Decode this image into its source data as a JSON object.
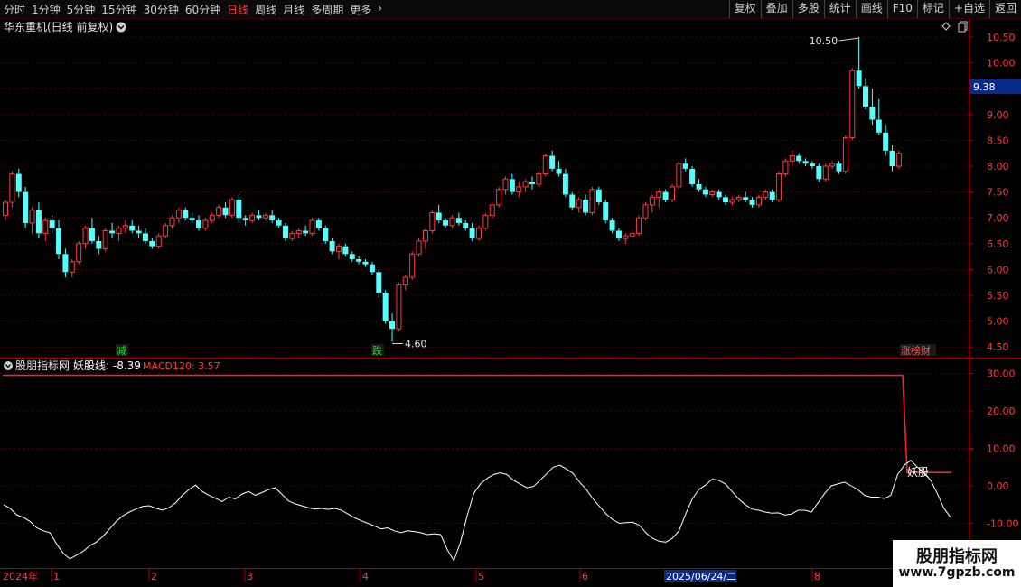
{
  "toolbar": {
    "left_items": [
      "分时",
      "1分钟",
      "5分钟",
      "15分钟",
      "30分钟",
      "60分钟",
      "日线",
      "周线",
      "月线",
      "多周期",
      "更多"
    ],
    "active": "日线",
    "right_items": [
      "复权",
      "叠加",
      "多股",
      "统计",
      "画线",
      "F10",
      "标记",
      "+自选",
      "返回"
    ]
  },
  "header": {
    "stock_title": "华东重机(日线 前复权)"
  },
  "price_panel": {
    "y_ticks": [
      "10.50",
      "10.00",
      "9.50",
      "9.00",
      "8.50",
      "8.00",
      "7.50",
      "7.00",
      "6.50",
      "6.00",
      "5.50",
      "5.00",
      "4.50"
    ],
    "current_price": "9.38",
    "max_label": "10.50",
    "min_label": "4.60",
    "markers": [
      {
        "text": "减",
        "color": "#2bdc2b"
      },
      {
        "text": "跌",
        "color": "#2bdc2b"
      },
      {
        "text": "涨榜财",
        "color": "#ff5a5a"
      }
    ]
  },
  "indicator_panel": {
    "name": "股朋指标网",
    "line1_label": "妖股线: -8.39",
    "line2_label": "MACD120: 3.57",
    "y_ticks": [
      "30.00",
      "20.00",
      "10.00",
      "0.00",
      "-10.00"
    ],
    "signal_label": "妖股"
  },
  "date_axis": {
    "year_label": "2024年",
    "month_labels": [
      "1",
      "2",
      "3",
      "4",
      "5",
      "6",
      "8"
    ],
    "selected_date": "2025/06/24/二"
  },
  "watermark": {
    "line1": "股朋指标网",
    "line2": "www.7gpzb.com"
  },
  "colors": {
    "up": "#ff3b3b",
    "down": "#54ffff",
    "bg": "#000000",
    "grid": "#7a0000",
    "axis": "#aa0000"
  },
  "chart_data": {
    "type": "candlestick",
    "title": "华东重机(日线 前复权)",
    "ylim": [
      4.35,
      10.65
    ],
    "candles": [
      [
        7.05,
        7.35,
        6.95,
        7.3
      ],
      [
        7.3,
        7.9,
        7.2,
        7.85
      ],
      [
        7.85,
        7.95,
        7.4,
        7.5
      ],
      [
        7.5,
        7.6,
        6.8,
        6.9
      ],
      [
        6.9,
        7.2,
        6.7,
        7.15
      ],
      [
        7.15,
        7.3,
        6.6,
        6.7
      ],
      [
        6.7,
        7.0,
        6.55,
        6.95
      ],
      [
        6.95,
        7.05,
        6.7,
        6.8
      ],
      [
        6.8,
        6.95,
        6.2,
        6.3
      ],
      [
        6.3,
        6.4,
        5.85,
        5.95
      ],
      [
        5.95,
        6.2,
        5.85,
        6.15
      ],
      [
        6.15,
        6.55,
        6.1,
        6.5
      ],
      [
        6.5,
        6.85,
        6.4,
        6.8
      ],
      [
        6.8,
        7.0,
        6.5,
        6.55
      ],
      [
        6.55,
        6.65,
        6.3,
        6.4
      ],
      [
        6.4,
        6.8,
        6.35,
        6.75
      ],
      [
        6.75,
        6.9,
        6.6,
        6.7
      ],
      [
        6.7,
        6.85,
        6.55,
        6.8
      ],
      [
        6.8,
        6.95,
        6.7,
        6.85
      ],
      [
        6.85,
        6.95,
        6.7,
        6.75
      ],
      [
        6.75,
        6.85,
        6.6,
        6.7
      ],
      [
        6.7,
        6.8,
        6.5,
        6.55
      ],
      [
        6.55,
        6.6,
        6.4,
        6.45
      ],
      [
        6.45,
        6.7,
        6.4,
        6.65
      ],
      [
        6.65,
        6.9,
        6.6,
        6.85
      ],
      [
        6.85,
        7.05,
        6.8,
        7.0
      ],
      [
        7.0,
        7.2,
        6.9,
        7.15
      ],
      [
        7.15,
        7.2,
        6.95,
        7.0
      ],
      [
        7.0,
        7.1,
        6.9,
        6.95
      ],
      [
        6.95,
        7.05,
        6.75,
        6.8
      ],
      [
        6.8,
        7.0,
        6.75,
        6.95
      ],
      [
        6.95,
        7.1,
        6.9,
        7.05
      ],
      [
        7.05,
        7.25,
        7.0,
        7.2
      ],
      [
        7.2,
        7.3,
        7.0,
        7.05
      ],
      [
        7.05,
        7.4,
        7.0,
        7.35
      ],
      [
        7.35,
        7.45,
        6.9,
        7.0
      ],
      [
        7.0,
        7.05,
        6.85,
        6.95
      ],
      [
        6.95,
        7.1,
        6.9,
        7.05
      ],
      [
        7.05,
        7.15,
        6.95,
        7.0
      ],
      [
        7.0,
        7.1,
        6.95,
        7.05
      ],
      [
        7.05,
        7.15,
        6.9,
        6.95
      ],
      [
        6.95,
        7.0,
        6.8,
        6.85
      ],
      [
        6.85,
        6.9,
        6.55,
        6.6
      ],
      [
        6.6,
        6.75,
        6.55,
        6.7
      ],
      [
        6.7,
        6.8,
        6.6,
        6.75
      ],
      [
        6.75,
        6.85,
        6.65,
        6.7
      ],
      [
        6.7,
        7.0,
        6.65,
        6.95
      ],
      [
        6.95,
        7.0,
        6.75,
        6.8
      ],
      [
        6.8,
        6.85,
        6.5,
        6.55
      ],
      [
        6.55,
        6.6,
        6.3,
        6.35
      ],
      [
        6.35,
        6.5,
        6.2,
        6.45
      ],
      [
        6.45,
        6.5,
        6.25,
        6.3
      ],
      [
        6.3,
        6.35,
        6.15,
        6.2
      ],
      [
        6.2,
        6.25,
        6.1,
        6.15
      ],
      [
        6.15,
        6.2,
        6.05,
        6.1
      ],
      [
        6.1,
        6.15,
        5.9,
        5.95
      ],
      [
        5.95,
        6.0,
        5.45,
        5.55
      ],
      [
        5.55,
        5.6,
        4.95,
        5.0
      ],
      [
        5.0,
        5.15,
        4.6,
        4.85
      ],
      [
        4.85,
        5.75,
        4.8,
        5.7
      ],
      [
        5.7,
        5.9,
        5.6,
        5.85
      ],
      [
        5.85,
        6.35,
        5.8,
        6.3
      ],
      [
        6.3,
        6.6,
        6.25,
        6.55
      ],
      [
        6.55,
        6.8,
        6.4,
        6.75
      ],
      [
        6.75,
        7.15,
        6.7,
        7.1
      ],
      [
        7.1,
        7.25,
        6.9,
        6.95
      ],
      [
        6.95,
        7.0,
        6.8,
        6.85
      ],
      [
        6.85,
        7.05,
        6.8,
        7.0
      ],
      [
        7.0,
        7.1,
        6.85,
        6.9
      ],
      [
        6.9,
        6.95,
        6.75,
        6.8
      ],
      [
        6.8,
        6.9,
        6.55,
        6.6
      ],
      [
        6.6,
        6.85,
        6.55,
        6.8
      ],
      [
        6.8,
        7.1,
        6.75,
        7.05
      ],
      [
        7.05,
        7.3,
        7.0,
        7.25
      ],
      [
        7.25,
        7.6,
        7.2,
        7.55
      ],
      [
        7.55,
        7.8,
        7.45,
        7.75
      ],
      [
        7.75,
        7.85,
        7.45,
        7.5
      ],
      [
        7.5,
        7.7,
        7.4,
        7.6
      ],
      [
        7.6,
        7.75,
        7.5,
        7.7
      ],
      [
        7.7,
        7.8,
        7.55,
        7.65
      ],
      [
        7.65,
        7.9,
        7.6,
        7.85
      ],
      [
        7.85,
        8.25,
        7.8,
        8.2
      ],
      [
        8.2,
        8.3,
        7.9,
        7.95
      ],
      [
        7.95,
        8.1,
        7.8,
        7.85
      ],
      [
        7.85,
        7.95,
        7.4,
        7.45
      ],
      [
        7.45,
        7.5,
        7.15,
        7.2
      ],
      [
        7.2,
        7.4,
        7.1,
        7.35
      ],
      [
        7.35,
        7.45,
        7.05,
        7.1
      ],
      [
        7.1,
        7.6,
        7.05,
        7.55
      ],
      [
        7.55,
        7.6,
        7.25,
        7.3
      ],
      [
        7.3,
        7.35,
        6.9,
        6.95
      ],
      [
        6.95,
        7.0,
        6.7,
        6.75
      ],
      [
        6.75,
        6.8,
        6.55,
        6.6
      ],
      [
        6.6,
        6.7,
        6.5,
        6.65
      ],
      [
        6.65,
        6.75,
        6.6,
        6.7
      ],
      [
        6.7,
        7.05,
        6.65,
        7.0
      ],
      [
        7.0,
        7.3,
        6.95,
        7.25
      ],
      [
        7.25,
        7.45,
        7.1,
        7.4
      ],
      [
        7.4,
        7.55,
        7.2,
        7.5
      ],
      [
        7.5,
        7.55,
        7.3,
        7.35
      ],
      [
        7.35,
        7.65,
        7.3,
        7.6
      ],
      [
        7.6,
        8.1,
        7.55,
        8.05
      ],
      [
        8.05,
        8.15,
        7.9,
        7.95
      ],
      [
        7.95,
        8.0,
        7.6,
        7.65
      ],
      [
        7.65,
        7.75,
        7.5,
        7.55
      ],
      [
        7.55,
        7.6,
        7.4,
        7.45
      ],
      [
        7.45,
        7.55,
        7.4,
        7.5
      ],
      [
        7.5,
        7.55,
        7.35,
        7.4
      ],
      [
        7.4,
        7.45,
        7.25,
        7.3
      ],
      [
        7.3,
        7.4,
        7.25,
        7.35
      ],
      [
        7.35,
        7.45,
        7.3,
        7.4
      ],
      [
        7.4,
        7.5,
        7.3,
        7.35
      ],
      [
        7.35,
        7.4,
        7.2,
        7.25
      ],
      [
        7.25,
        7.45,
        7.2,
        7.4
      ],
      [
        7.4,
        7.55,
        7.35,
        7.5
      ],
      [
        7.5,
        7.55,
        7.3,
        7.35
      ],
      [
        7.35,
        7.9,
        7.3,
        7.85
      ],
      [
        7.85,
        8.15,
        7.8,
        8.1
      ],
      [
        8.1,
        8.3,
        8.0,
        8.2
      ],
      [
        8.2,
        8.25,
        8.05,
        8.1
      ],
      [
        8.1,
        8.15,
        8.0,
        8.05
      ],
      [
        8.05,
        8.1,
        7.95,
        8.0
      ],
      [
        8.0,
        8.05,
        7.7,
        7.75
      ],
      [
        7.75,
        8.05,
        7.7,
        8.0
      ],
      [
        8.0,
        8.1,
        7.95,
        8.05
      ],
      [
        8.05,
        8.1,
        7.85,
        7.9
      ],
      [
        7.9,
        8.6,
        7.85,
        8.55
      ],
      [
        8.55,
        9.9,
        8.5,
        9.85
      ],
      [
        9.85,
        10.5,
        9.5,
        9.55
      ],
      [
        9.55,
        9.7,
        9.1,
        9.15
      ],
      [
        9.15,
        9.5,
        8.8,
        8.9
      ],
      [
        8.9,
        9.3,
        8.6,
        8.65
      ],
      [
        8.65,
        8.8,
        8.2,
        8.3
      ],
      [
        8.3,
        8.4,
        7.9,
        8.0
      ],
      [
        8.0,
        8.3,
        7.95,
        8.25
      ]
    ],
    "indicator": {
      "yaokuxian_name": "妖股线",
      "yaokuxian_last": -8.39,
      "macd120_name": "MACD120",
      "macd120_last": 3.57,
      "macd120_step": [
        29.5,
        29.5,
        3.57,
        3.57
      ],
      "yaokuxian": [
        -5.0,
        -6.0,
        -7.8,
        -8.4,
        -9.5,
        -11.2,
        -12.0,
        -12.5,
        -15.5,
        -18.0,
        -19.5,
        -18.5,
        -17.5,
        -16.0,
        -15.0,
        -13.5,
        -11.5,
        -9.5,
        -8.0,
        -7.0,
        -6.2,
        -5.5,
        -5.3,
        -6.0,
        -6.5,
        -5.8,
        -4.5,
        -2.5,
        -1.0,
        0.2,
        -1.5,
        -2.5,
        -3.3,
        -4.2,
        -3.0,
        -3.5,
        -2.2,
        -1.5,
        -2.5,
        -1.8,
        -1.0,
        -0.5,
        -2.2,
        -4.0,
        -4.8,
        -5.3,
        -5.8,
        -6.2,
        -6.0,
        -6.3,
        -6.0,
        -6.5,
        -7.5,
        -8.5,
        -9.3,
        -10.0,
        -10.7,
        -11.5,
        -11.2,
        -12.0,
        -12.5,
        -12.0,
        -12.2,
        -12.5,
        -13.0,
        -12.8,
        -13.0,
        -17.0,
        -20.0,
        -15.0,
        -8.0,
        -2.0,
        0.5,
        2.0,
        3.0,
        3.5,
        3.0,
        1.5,
        0.5,
        -0.5,
        -0.2,
        1.5,
        3.2,
        5.0,
        5.5,
        4.5,
        3.3,
        1.0,
        -1.0,
        -3.5,
        -5.5,
        -7.5,
        -9.0,
        -10.0,
        -9.8,
        -9.7,
        -10.5,
        -12.5,
        -14.0,
        -14.8,
        -15.0,
        -14.0,
        -12.0,
        -7.5,
        -3.5,
        -1.0,
        0.2,
        1.8,
        1.5,
        0.5,
        -1.5,
        -3.5,
        -5.0,
        -6.2,
        -6.5,
        -7.0,
        -7.3,
        -7.2,
        -7.8,
        -7.5,
        -6.5,
        -6.5,
        -7.0,
        -4.5,
        -2.0,
        0.0,
        0.5,
        1.0,
        0.0,
        -1.0,
        -2.5,
        -3.0,
        -3.0,
        -3.4,
        -2.5,
        3.0,
        5.5,
        6.8,
        5.0,
        3.5,
        1.5,
        -2.0,
        -6.0,
        -8.39
      ]
    }
  }
}
